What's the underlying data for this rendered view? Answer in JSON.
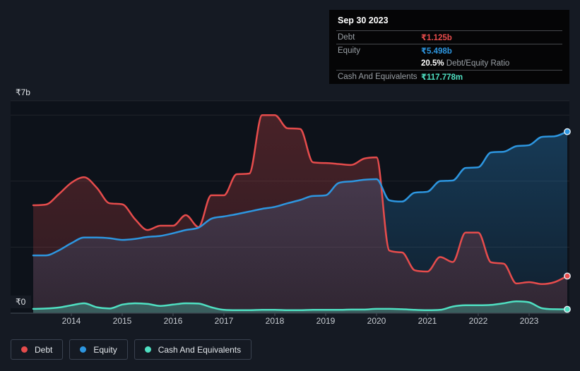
{
  "tooltip": {
    "date": "Sep 30 2023",
    "debt_label": "Debt",
    "debt_value": "₹1.125b",
    "equity_label": "Equity",
    "equity_value": "₹5.498b",
    "ratio_bold": "20.5%",
    "ratio_rest": " Debt/Equity Ratio",
    "cash_label": "Cash And Equivalents",
    "cash_value": "₹117.778m"
  },
  "axis": {
    "y_max_label": "₹7b",
    "y_min_label": "₹0",
    "year_labels": [
      "2014",
      "2015",
      "2016",
      "2017",
      "2018",
      "2019",
      "2020",
      "2021",
      "2022",
      "2023"
    ]
  },
  "legend": {
    "items": [
      {
        "label": "Debt",
        "color": "#e64c4c"
      },
      {
        "label": "Equity",
        "color": "#2d96e0"
      },
      {
        "label": "Cash And Equivalents",
        "color": "#4fe0c2"
      }
    ]
  },
  "colors": {
    "debt": "#e64c4c",
    "equity": "#2d96e0",
    "cash": "#4fe0c2",
    "ratio_value": "#ffffff",
    "label_gray": "#9aa0a6",
    "page_bg": "#151a23",
    "plot_bg": "#0d121a"
  },
  "chart_data": {
    "type": "area",
    "title": "Debt to Equity History",
    "unit": "₹ billions",
    "ylim": [
      0,
      7
    ],
    "y_axis_labels": [
      "₹7b",
      "₹0"
    ],
    "gridline_values": [
      2,
      4,
      6
    ],
    "legend_position": "bottom-left",
    "x_range": [
      2013.25,
      2023.75
    ],
    "x_years": [
      2013.25,
      2013.5,
      2013.75,
      2014,
      2014.25,
      2014.5,
      2014.75,
      2015,
      2015.25,
      2015.5,
      2015.75,
      2016,
      2016.25,
      2016.5,
      2016.75,
      2017,
      2017.25,
      2017.5,
      2017.75,
      2018,
      2018.25,
      2018.5,
      2018.75,
      2019,
      2019.25,
      2019.5,
      2019.75,
      2020,
      2020.25,
      2020.5,
      2020.75,
      2021,
      2021.25,
      2021.5,
      2021.75,
      2022,
      2022.25,
      2022.5,
      2022.75,
      2023,
      2023.25,
      2023.5,
      2023.75
    ],
    "series": [
      {
        "name": "Debt",
        "color": "#e64c4c",
        "values": [
          3.27,
          3.29,
          3.6,
          3.95,
          4.12,
          3.8,
          3.33,
          3.3,
          2.85,
          2.52,
          2.65,
          2.65,
          2.97,
          2.61,
          3.57,
          3.57,
          4.21,
          4.23,
          6.0,
          6.0,
          5.6,
          5.58,
          4.57,
          4.55,
          4.52,
          4.49,
          4.68,
          4.72,
          1.9,
          1.84,
          1.3,
          1.26,
          1.7,
          1.55,
          2.44,
          2.44,
          1.54,
          1.5,
          0.9,
          0.94,
          0.88,
          0.94,
          1.125
        ]
      },
      {
        "name": "Equity",
        "color": "#2d96e0",
        "values": [
          1.75,
          1.75,
          1.9,
          2.12,
          2.29,
          2.29,
          2.27,
          2.22,
          2.25,
          2.31,
          2.34,
          2.42,
          2.52,
          2.59,
          2.86,
          2.93,
          3.0,
          3.08,
          3.16,
          3.22,
          3.33,
          3.43,
          3.55,
          3.57,
          3.94,
          3.99,
          4.04,
          4.06,
          3.42,
          3.38,
          3.65,
          3.68,
          4.0,
          4.02,
          4.4,
          4.42,
          4.87,
          4.89,
          5.06,
          5.09,
          5.34,
          5.36,
          5.498
        ]
      },
      {
        "name": "Cash And Equivalents",
        "color": "#4fe0c2",
        "values": [
          0.13,
          0.14,
          0.17,
          0.24,
          0.3,
          0.18,
          0.14,
          0.26,
          0.3,
          0.28,
          0.22,
          0.26,
          0.3,
          0.29,
          0.18,
          0.1,
          0.09,
          0.09,
          0.1,
          0.1,
          0.09,
          0.09,
          0.1,
          0.1,
          0.1,
          0.11,
          0.11,
          0.13,
          0.13,
          0.12,
          0.1,
          0.09,
          0.1,
          0.2,
          0.24,
          0.24,
          0.25,
          0.3,
          0.36,
          0.33,
          0.15,
          0.12,
          0.118
        ]
      }
    ],
    "end_values": {
      "Debt": "₹1.125b",
      "Equity": "₹5.498b",
      "Cash And Equivalents": "₹117.778m"
    },
    "end_date": "Sep 30 2023",
    "debt_equity_ratio": "20.5%"
  }
}
